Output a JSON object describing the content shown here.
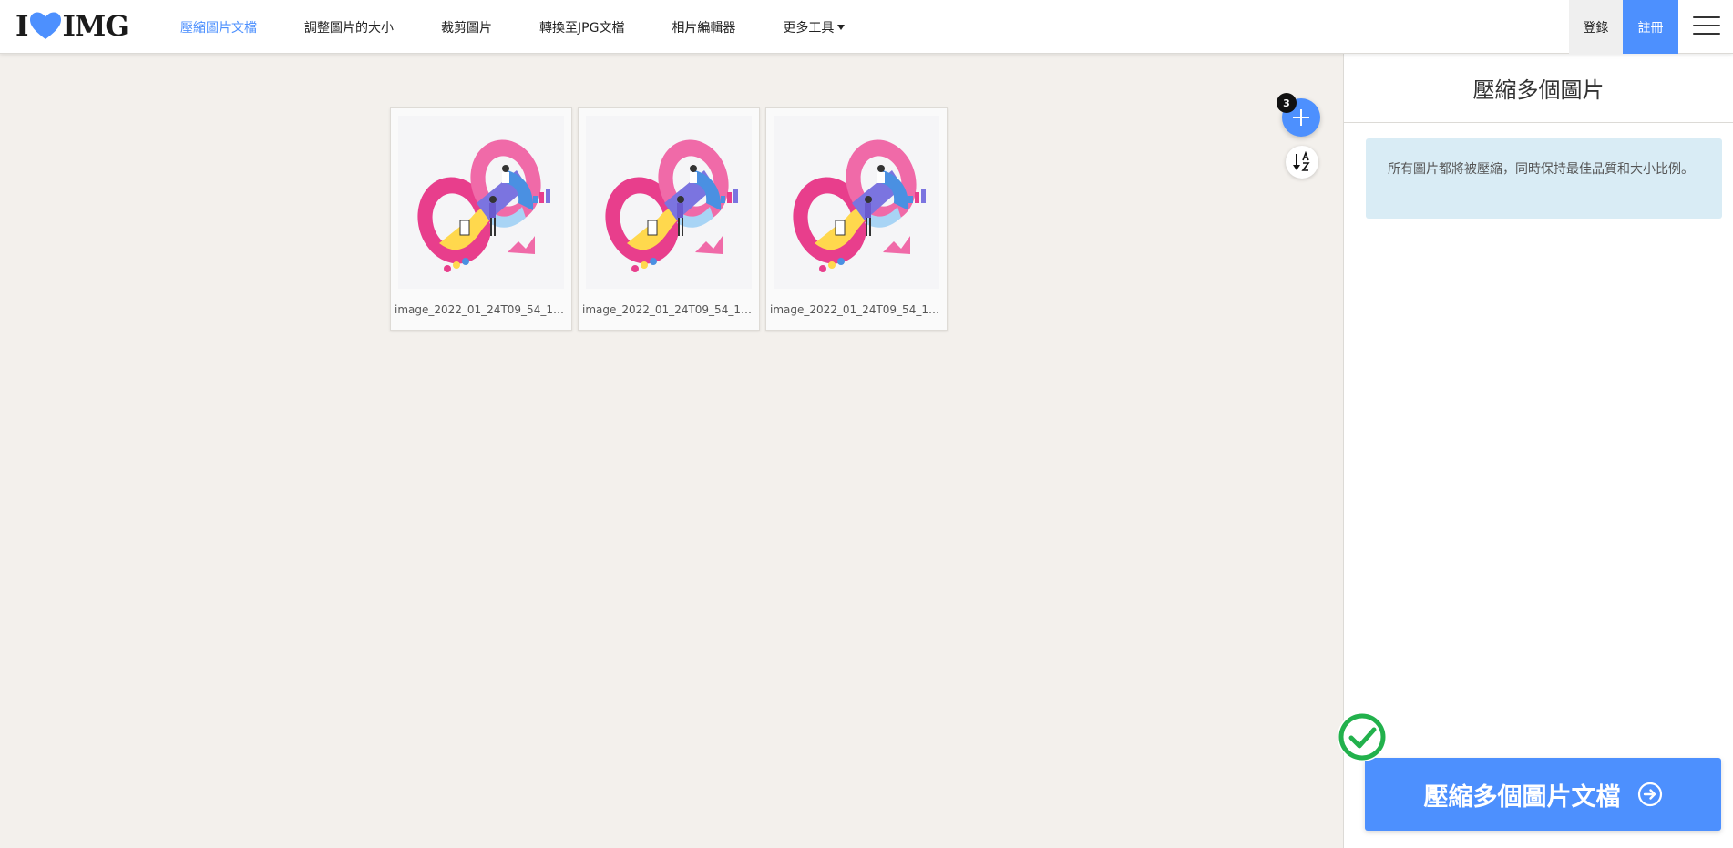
{
  "header": {
    "logo_left": "I",
    "logo_right": "IMG",
    "nav": [
      {
        "label": "壓縮圖片文檔",
        "active": true
      },
      {
        "label": "調整圖片的大小"
      },
      {
        "label": "裁剪圖片"
      },
      {
        "label": "轉換至JPG文檔"
      },
      {
        "label": "相片編輯器"
      },
      {
        "label": "更多工具"
      }
    ],
    "login_label": "登錄",
    "signup_label": "註冊"
  },
  "workspace": {
    "file_count": "3",
    "files": [
      {
        "name": "image_2022_01_24T09_54_19_..."
      },
      {
        "name": "image_2022_01_24T09_54_19_..."
      },
      {
        "name": "image_2022_01_24T09_54_19_..."
      }
    ]
  },
  "sidebar": {
    "title": "壓縮多個圖片",
    "info_text": "所有圖片都將被壓縮，同時保持最佳品質和大小比例。",
    "action_label": "壓縮多個圖片文檔"
  },
  "colors": {
    "accent": "#4d90fe",
    "background": "#f3f0ec",
    "info_box": "#d9ecf5",
    "success": "#22b14c"
  }
}
